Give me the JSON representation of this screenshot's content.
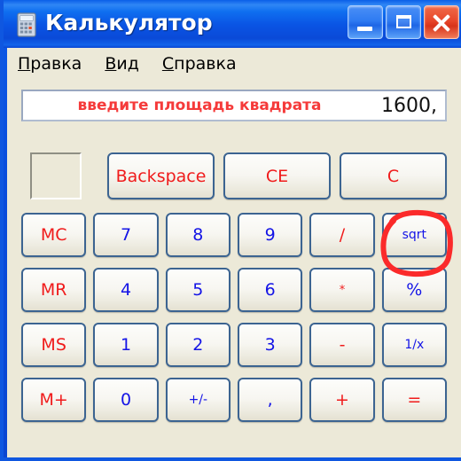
{
  "window": {
    "title": "Калькулятор",
    "icon": "calculator-icon",
    "controls": {
      "minimize": "minimize-icon",
      "maximize": "maximize-icon",
      "close": "close-icon"
    }
  },
  "menu": {
    "items": [
      {
        "mnemonic": "П",
        "rest": "равка"
      },
      {
        "mnemonic": "В",
        "rest": "ид"
      },
      {
        "mnemonic": "С",
        "rest": "правка"
      }
    ]
  },
  "display": {
    "hint": "введите площадь квадрата",
    "value": "1600,"
  },
  "memory": {
    "indicator": ""
  },
  "top_row": [
    {
      "label": "Backspace",
      "color": "red"
    },
    {
      "label": "CE",
      "color": "red"
    },
    {
      "label": "C",
      "color": "red"
    }
  ],
  "keypad": [
    {
      "label": "MC",
      "color": "red",
      "size": "normal"
    },
    {
      "label": "7",
      "color": "blue",
      "size": "normal"
    },
    {
      "label": "8",
      "color": "blue",
      "size": "normal"
    },
    {
      "label": "9",
      "color": "blue",
      "size": "normal"
    },
    {
      "label": "/",
      "color": "red",
      "size": "normal"
    },
    {
      "label": "sqrt",
      "color": "blue",
      "size": "small"
    },
    {
      "label": "MR",
      "color": "red",
      "size": "normal"
    },
    {
      "label": "4",
      "color": "blue",
      "size": "normal"
    },
    {
      "label": "5",
      "color": "blue",
      "size": "normal"
    },
    {
      "label": "6",
      "color": "blue",
      "size": "normal"
    },
    {
      "label": "*",
      "color": "red",
      "size": "tiny"
    },
    {
      "label": "%",
      "color": "blue",
      "size": "normal"
    },
    {
      "label": "MS",
      "color": "red",
      "size": "normal"
    },
    {
      "label": "1",
      "color": "blue",
      "size": "normal"
    },
    {
      "label": "2",
      "color": "blue",
      "size": "normal"
    },
    {
      "label": "3",
      "color": "blue",
      "size": "normal"
    },
    {
      "label": "-",
      "color": "red",
      "size": "normal"
    },
    {
      "label": "1/x",
      "color": "blue",
      "size": "small"
    },
    {
      "label": "M+",
      "color": "red",
      "size": "normal"
    },
    {
      "label": "0",
      "color": "blue",
      "size": "normal"
    },
    {
      "label": "+/-",
      "color": "blue",
      "size": "small"
    },
    {
      "label": ",",
      "color": "blue",
      "size": "normal"
    },
    {
      "label": "+",
      "color": "red",
      "size": "normal"
    },
    {
      "label": "=",
      "color": "red",
      "size": "normal"
    }
  ],
  "annotation": {
    "target": "sqrt",
    "shape": "hand-drawn-ellipse",
    "color": "#fb2a2a"
  },
  "colors": {
    "titlebar_blue": "#0a54e4",
    "client_beige": "#ece9d8",
    "button_border": "#3c6491",
    "label_blue": "#1414e6",
    "label_red": "#f01b1b",
    "hint_red": "#f53a3a",
    "annotation_red": "#fb2a2a"
  }
}
